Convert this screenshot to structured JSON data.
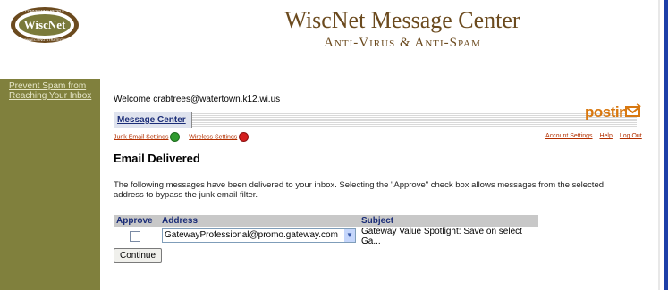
{
  "header": {
    "title": "WiscNet Message Center",
    "subtitle": "Anti-Virus & Anti-Spam",
    "logo": {
      "top_text": "CONNECTING PEOPLE",
      "name": "WiscNet",
      "bottom_text": "CONNECTING STRATEGIES"
    }
  },
  "sidebar": {
    "link": "Prevent Spam from Reaching Your Inbox"
  },
  "welcome": "Welcome crabtrees@watertown.k12.wi.us",
  "nav": {
    "tab": "Message Center",
    "brand": "postini"
  },
  "links": {
    "junk": "Junk Email Settings",
    "wireless": "Wireless Settings",
    "account": "Account Settings",
    "help": "Help",
    "logout": "Log Out"
  },
  "section": {
    "heading": "Email Delivered",
    "description": "The following messages have been delivered to your inbox. Selecting the \"Approve\" check box allows messages from the selected address to bypass the junk email filter."
  },
  "table": {
    "headers": [
      "Approve",
      "Address",
      "Subject"
    ],
    "rows": [
      {
        "approve": false,
        "address": "GatewayProfessional@promo.gateway.com",
        "subject": "Gateway Value Spotlight: Save on select Ga..."
      }
    ]
  },
  "buttons": {
    "continue": "Continue"
  },
  "colors": {
    "sidebar": "#80803d",
    "title": "#6b4a1e",
    "brand": "#d87810",
    "link": "#b33000"
  }
}
